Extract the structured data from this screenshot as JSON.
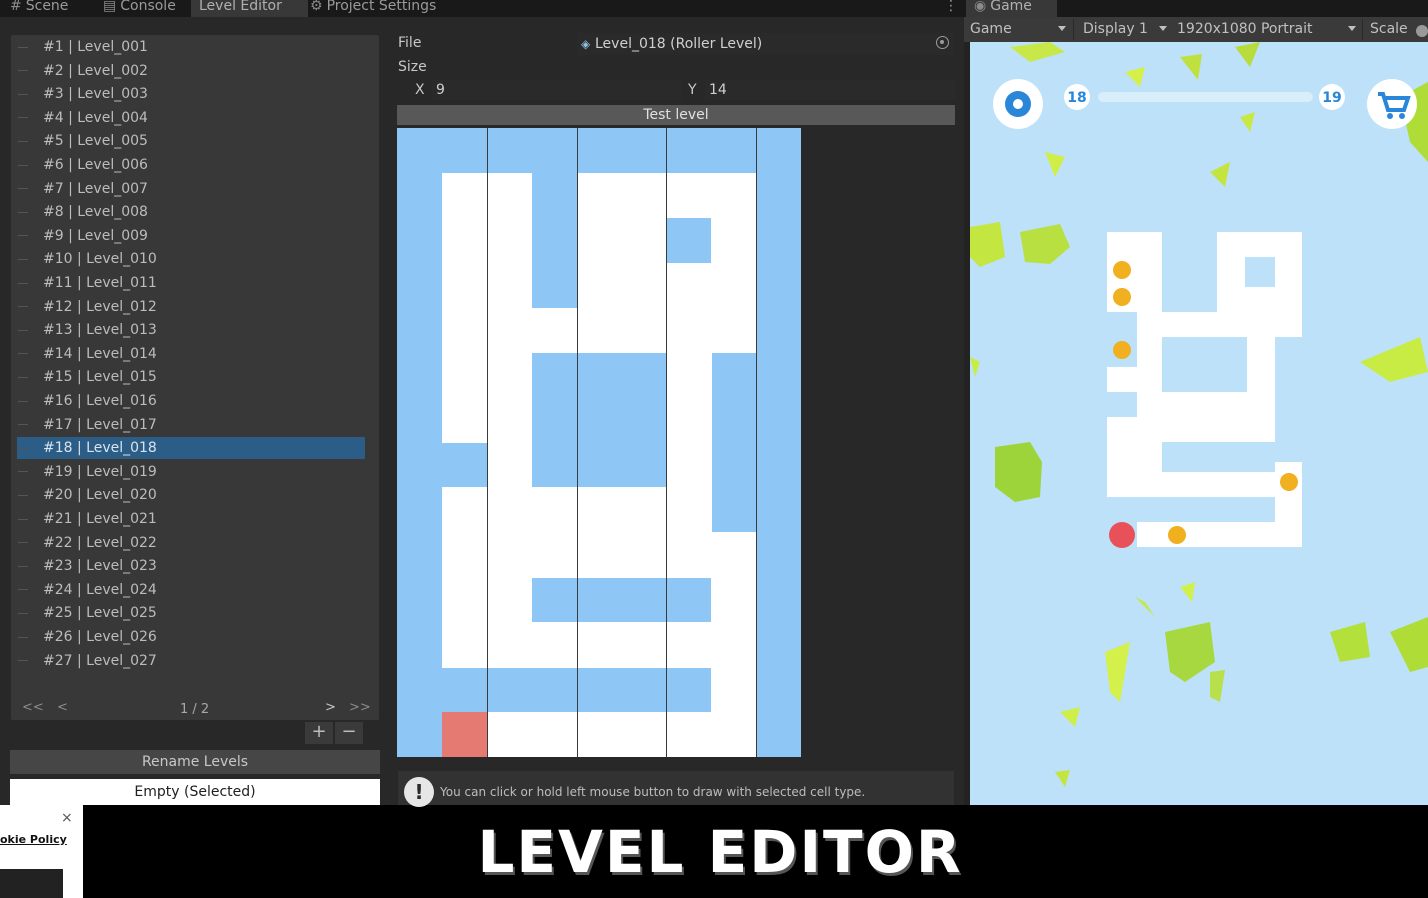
{
  "tabs": [
    {
      "icon": "#",
      "label": "Scene"
    },
    {
      "icon": "▤",
      "label": "Console"
    },
    {
      "icon": "",
      "label": "Level Editor"
    },
    {
      "icon": "⚙",
      "label": "Project Settings"
    }
  ],
  "tab_menu": "⋮",
  "levels": [
    "#1 | Level_001",
    "#2 | Level_002",
    "#3 | Level_003",
    "#4 | Level_004",
    "#5 | Level_005",
    "#6 | Level_006",
    "#7 | Level_007",
    "#8 | Level_008",
    "#9 | Level_009",
    "#10 | Level_010",
    "#11 | Level_011",
    "#12 | Level_012",
    "#13 | Level_013",
    "#14 | Level_014",
    "#15 | Level_015",
    "#16 | Level_016",
    "#17 | Level_017",
    "#18 | Level_018",
    "#19 | Level_019",
    "#20 | Level_020",
    "#21 | Level_021",
    "#22 | Level_022",
    "#23 | Level_023",
    "#24 | Level_024",
    "#25 | Level_025",
    "#26 | Level_026",
    "#27 | Level_027"
  ],
  "selected_level": "#18 | Level_018",
  "pager": {
    "first": "<<",
    "prev": "<",
    "page": "1 / 2",
    "next": ">",
    "last": ">>"
  },
  "list_buttons": {
    "add": "+",
    "remove": "−"
  },
  "rename_button": "Rename Levels",
  "cell_type_button": "Empty (Selected)",
  "properties": {
    "file_label": "File",
    "file_value": "Level_018 (Roller Level)",
    "size_label": "Size",
    "x_label": "X",
    "x_value": "9",
    "y_label": "Y",
    "y_value": "14"
  },
  "test_button": "Test level",
  "grid": {
    "columns": 9,
    "rows": 14,
    "colors": {
      "empty": "#8ec6f5",
      "floor": "#ffffff",
      "start": "#e57a72"
    },
    "floor_cells": [
      [
        1,
        1
      ],
      [
        2,
        1
      ],
      [
        4,
        1
      ],
      [
        5,
        1
      ],
      [
        6,
        1
      ],
      [
        7,
        1
      ],
      [
        1,
        2
      ],
      [
        2,
        2
      ],
      [
        4,
        2
      ],
      [
        5,
        2
      ],
      [
        7,
        2
      ],
      [
        1,
        3
      ],
      [
        2,
        3
      ],
      [
        4,
        3
      ],
      [
        5,
        3
      ],
      [
        6,
        3
      ],
      [
        7,
        3
      ],
      [
        1,
        4
      ],
      [
        2,
        4
      ],
      [
        3,
        4
      ],
      [
        4,
        4
      ],
      [
        5,
        4
      ],
      [
        6,
        4
      ],
      [
        7,
        4
      ],
      [
        1,
        5
      ],
      [
        2,
        5
      ],
      [
        6,
        5
      ],
      [
        1,
        6
      ],
      [
        2,
        6
      ],
      [
        6,
        6
      ],
      [
        2,
        7
      ],
      [
        6,
        7
      ],
      [
        1,
        8
      ],
      [
        2,
        8
      ],
      [
        3,
        8
      ],
      [
        4,
        8
      ],
      [
        5,
        8
      ],
      [
        6,
        8
      ],
      [
        1,
        9
      ],
      [
        2,
        9
      ],
      [
        3,
        9
      ],
      [
        4,
        9
      ],
      [
        5,
        9
      ],
      [
        6,
        9
      ],
      [
        7,
        9
      ],
      [
        1,
        10
      ],
      [
        2,
        10
      ],
      [
        7,
        10
      ],
      [
        1,
        11
      ],
      [
        2,
        11
      ],
      [
        3,
        11
      ],
      [
        4,
        11
      ],
      [
        5,
        11
      ],
      [
        6,
        11
      ],
      [
        7,
        11
      ],
      [
        7,
        12
      ],
      [
        2,
        13
      ],
      [
        3,
        13
      ],
      [
        4,
        13
      ],
      [
        5,
        13
      ],
      [
        6,
        13
      ],
      [
        7,
        13
      ]
    ],
    "start_cell": [
      1,
      13
    ],
    "divider_columns": [
      2,
      4,
      6,
      8
    ]
  },
  "hint_text": "You can click or hold left mouse button to draw with selected cell type.",
  "game": {
    "tab_label": "Game",
    "mode": "Game",
    "display": "Display 1",
    "resolution": "1920x1080 Portrait",
    "scale_label": "Scale",
    "level_current": "18",
    "level_next": "19",
    "progress": 0
  },
  "cookie": {
    "close": "×",
    "link_text": "okie Policy"
  },
  "caption": "LEVEL EDITOR"
}
